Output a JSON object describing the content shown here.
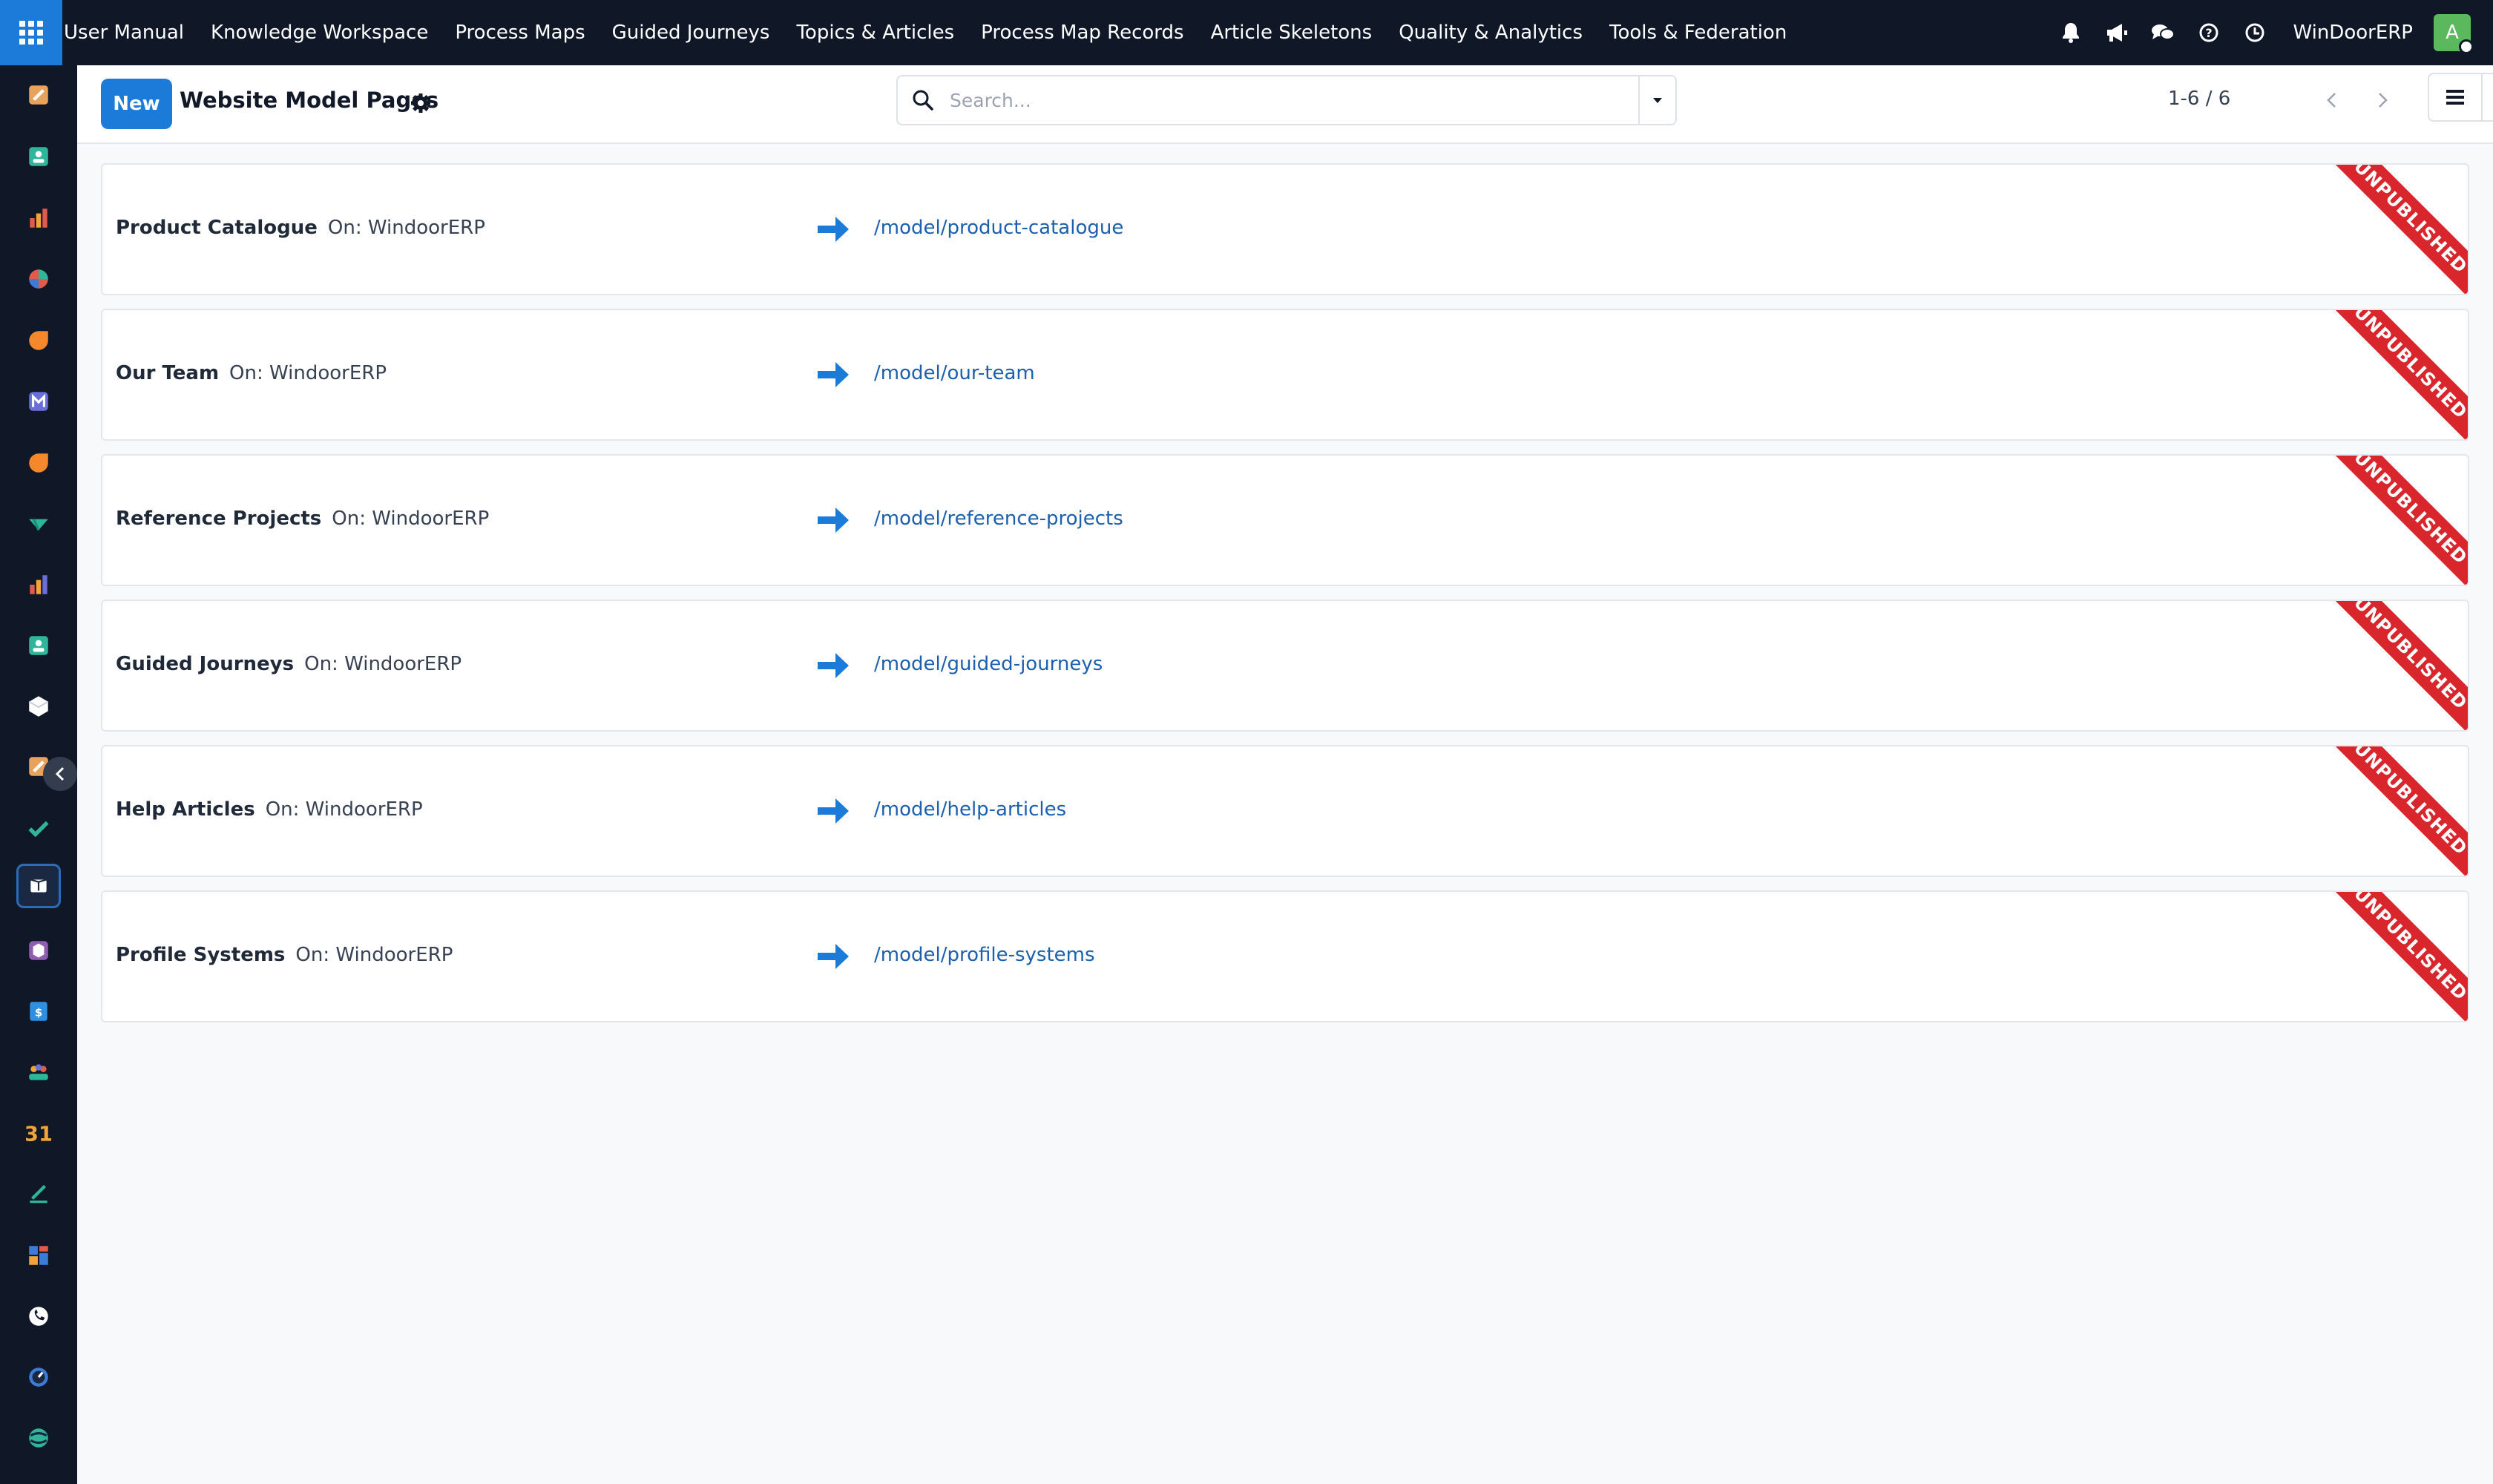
{
  "navbar": {
    "menu": [
      "User Manual",
      "Knowledge Workspace",
      "Process Maps",
      "Guided Journeys",
      "Topics & Articles",
      "Process Map Records",
      "Article Skeletons",
      "Quality & Analytics",
      "Tools & Federation"
    ],
    "company": "WinDoorERP",
    "avatar_initial": "A"
  },
  "control_panel": {
    "new_label": "New",
    "title": "Website Model Pages",
    "search_placeholder": "Search...",
    "pager_value": "1-6 / 6"
  },
  "records": [
    {
      "name": "Product Catalogue",
      "website": "On: WindoorERP",
      "url": "/model/product-catalogue",
      "status": "UNPUBLISHED"
    },
    {
      "name": "Our Team",
      "website": "On: WindoorERP",
      "url": "/model/our-team",
      "status": "UNPUBLISHED"
    },
    {
      "name": "Reference Projects",
      "website": "On: WindoorERP",
      "url": "/model/reference-projects",
      "status": "UNPUBLISHED"
    },
    {
      "name": "Guided Journeys",
      "website": "On: WindoorERP",
      "url": "/model/guided-journeys",
      "status": "UNPUBLISHED"
    },
    {
      "name": "Help Articles",
      "website": "On: WindoorERP",
      "url": "/model/help-articles",
      "status": "UNPUBLISHED"
    },
    {
      "name": "Profile Systems",
      "website": "On: WindoorERP",
      "url": "/model/profile-systems",
      "status": "UNPUBLISHED"
    }
  ],
  "colors": {
    "navbar_bg": "#101828",
    "primary": "#1c7bd8",
    "link": "#1b5fae",
    "ribbon": "#d9262c"
  },
  "rail_icons": [
    "documents-app-icon",
    "contacts-app-icon",
    "reporting-app-icon",
    "discuss-app-icon",
    "livechat-app-icon",
    "email-marketing-app-icon",
    "chat-app-icon",
    "project-app-icon",
    "dashboard-app-icon",
    "employees-app-icon",
    "inventory-app-icon",
    "studio-app-icon",
    "todo-app-icon",
    "knowledge-app-icon",
    "website-app-icon",
    "invoicing-app-icon",
    "team-app-icon",
    "calendar-app-icon",
    "sign-app-icon",
    "dashboards-app-icon",
    "whatsapp-app-icon",
    "timesheet-app-icon",
    "settings-app-icon"
  ]
}
